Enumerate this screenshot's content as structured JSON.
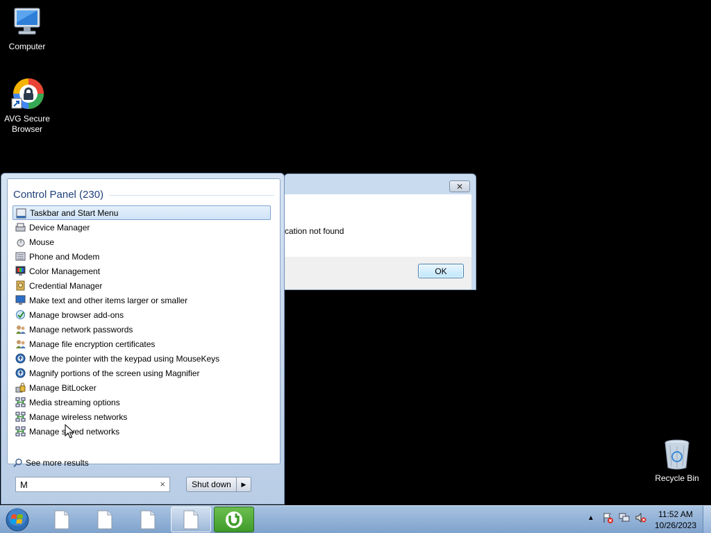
{
  "desktop": {
    "icons": [
      {
        "label_line1": "Computer",
        "label_line2": ""
      },
      {
        "label_line1": "AVG Secure",
        "label_line2": "Browser"
      },
      {
        "label_line1": "Recycle Bin",
        "label_line2": ""
      }
    ]
  },
  "dialog": {
    "close_symbol": "✕",
    "message": "cation not found",
    "ok_label": "OK"
  },
  "start_menu": {
    "heading": "Control Panel (230)",
    "items": [
      {
        "label": "Taskbar and Start Menu",
        "icon": "taskbar-icon"
      },
      {
        "label": "Device Manager",
        "icon": "device-manager-icon"
      },
      {
        "label": "Mouse",
        "icon": "mouse-icon"
      },
      {
        "label": "Phone and Modem",
        "icon": "phone-modem-icon"
      },
      {
        "label": "Color Management",
        "icon": "color-management-icon"
      },
      {
        "label": "Credential Manager",
        "icon": "credential-manager-icon"
      },
      {
        "label": "Make text and other items larger or smaller",
        "icon": "display-icon"
      },
      {
        "label": "Manage browser add-ons",
        "icon": "internet-options-icon"
      },
      {
        "label": "Manage network passwords",
        "icon": "user-accounts-icon"
      },
      {
        "label": "Manage file encryption certificates",
        "icon": "user-accounts-icon"
      },
      {
        "label": "Move the pointer with the keypad using MouseKeys",
        "icon": "ease-of-access-icon"
      },
      {
        "label": "Magnify portions of the screen using Magnifier",
        "icon": "ease-of-access-icon"
      },
      {
        "label": "Manage BitLocker",
        "icon": "bitlocker-icon"
      },
      {
        "label": "Media streaming options",
        "icon": "network-icon"
      },
      {
        "label": "Manage wireless networks",
        "icon": "network-icon"
      },
      {
        "label": "Manage saved networks",
        "icon": "network-icon"
      }
    ],
    "see_more": "See more results",
    "search_value": "M",
    "search_clear": "×",
    "shutdown_label": "Shut down",
    "shutdown_arrow": "▶"
  },
  "taskbar": {
    "time": "11:52 AM",
    "date": "10/26/2023",
    "tray_arrow": "▲"
  }
}
